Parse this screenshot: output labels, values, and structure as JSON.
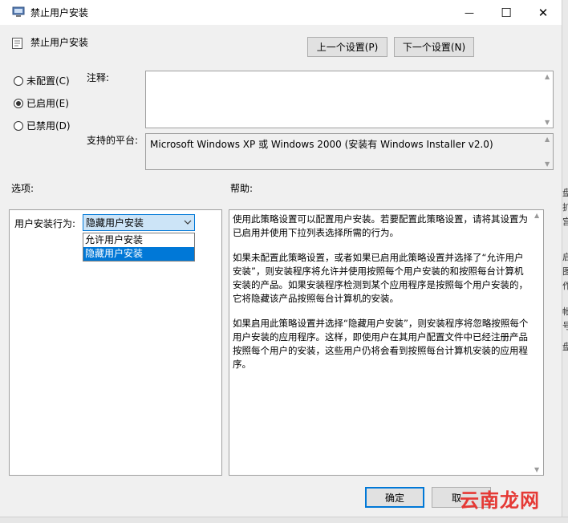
{
  "window": {
    "title": "禁止用户安装",
    "minimize_glyph": "—",
    "maximize_glyph": "☐",
    "close_glyph": "✕"
  },
  "header": {
    "policy_name": "禁止用户安装",
    "prev_button": "上一个设置(P)",
    "next_button": "下一个设置(N)"
  },
  "state": {
    "options": [
      {
        "label": "未配置(C)",
        "checked": false
      },
      {
        "label": "已启用(E)",
        "checked": true
      },
      {
        "label": "已禁用(D)",
        "checked": false
      }
    ]
  },
  "comment": {
    "label": "注释:",
    "value": ""
  },
  "platform": {
    "label": "支持的平台:",
    "value": "Microsoft Windows XP 或 Windows 2000 (安装有 Windows Installer v2.0)"
  },
  "options_section": {
    "label": "选项:",
    "field_label": "用户安装行为:",
    "selected": "隐藏用户安装",
    "dropdown_items": [
      "允许用户安装",
      "隐藏用户安装"
    ],
    "highlighted_index": 1
  },
  "help_section": {
    "label": "帮助:",
    "paragraphs": [
      "使用此策略设置可以配置用户安装。若要配置此策略设置，请将其设置为已启用并使用下拉列表选择所需的行为。",
      "如果未配置此策略设置，或者如果已启用此策略设置并选择了“允许用户安装”，则安装程序将允许并使用按照每个用户安装的和按照每台计算机安装的产品。如果安装程序检测到某个应用程序是按照每个用户安装的，它将隐藏该产品按照每台计算机的安装。",
      "如果启用此策略设置并选择“隐藏用户安装”，则安装程序将忽略按照每个用户安装的应用程序。这样，即使用户在其用户配置文件中已经注册产品按照每个用户的安装，这些用户仍将会看到按照每台计算机安装的应用程序。"
    ]
  },
  "footer": {
    "ok_button": "确定",
    "cancel_button": "取"
  },
  "watermark": {
    "text": "云南龙网"
  },
  "background_edge": {
    "fragments": [
      "盘",
      "扩",
      "宫",
      "启",
      "图",
      "作",
      "帐",
      "号",
      "盘"
    ]
  },
  "colors": {
    "accent": "#0078d7",
    "dropdown_selected_bg": "#cce4f7",
    "watermark": "#e53935"
  }
}
